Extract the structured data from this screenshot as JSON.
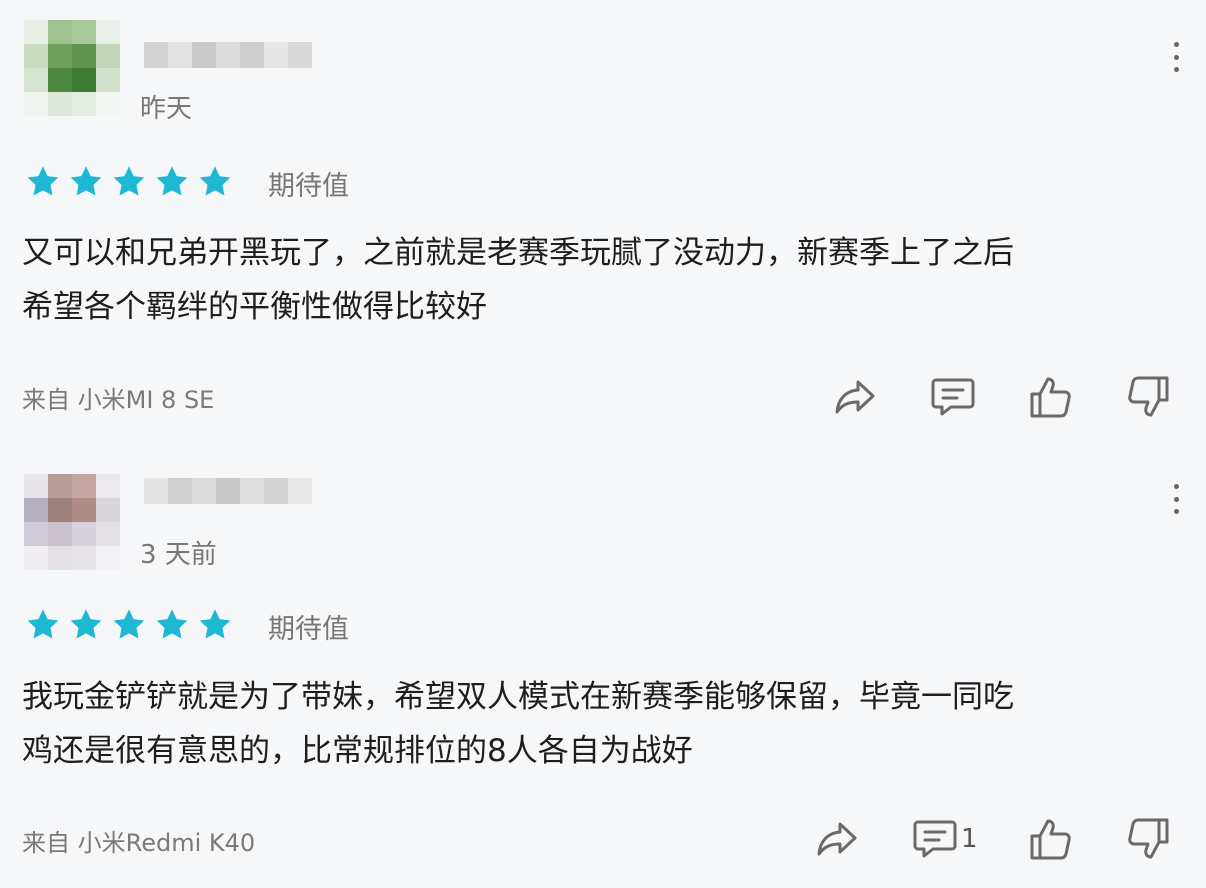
{
  "icons": {
    "star": "star-icon",
    "more": "more-vertical-icon",
    "share": "share-icon",
    "comment": "comment-icon",
    "like": "thumbs-up-icon",
    "dislike": "thumbs-down-icon"
  },
  "colors": {
    "star": "#1fb8d4",
    "icon": "#6a6a6a",
    "background": "#f6f7f9"
  },
  "reviews": [
    {
      "date": "昨天",
      "rating": 5,
      "tag": "期待值",
      "lines": [
        "又可以和兄弟开黑玩了，之前就是老赛季玩腻了没动力，新赛季上了之后",
        "希望各个羁绊的平衡性做得比较好"
      ],
      "device": "来自 小米MI 8 SE",
      "comment_count": ""
    },
    {
      "date": "3 天前",
      "rating": 5,
      "tag": "期待值",
      "lines": [
        "我玩金铲铲就是为了带妹，希望双人模式在新赛季能够保留，毕竟一同吃",
        "鸡还是很有意思的，比常规排位的8人各自为战好"
      ],
      "device": "来自 小米Redmi K40",
      "comment_count": "1"
    }
  ]
}
